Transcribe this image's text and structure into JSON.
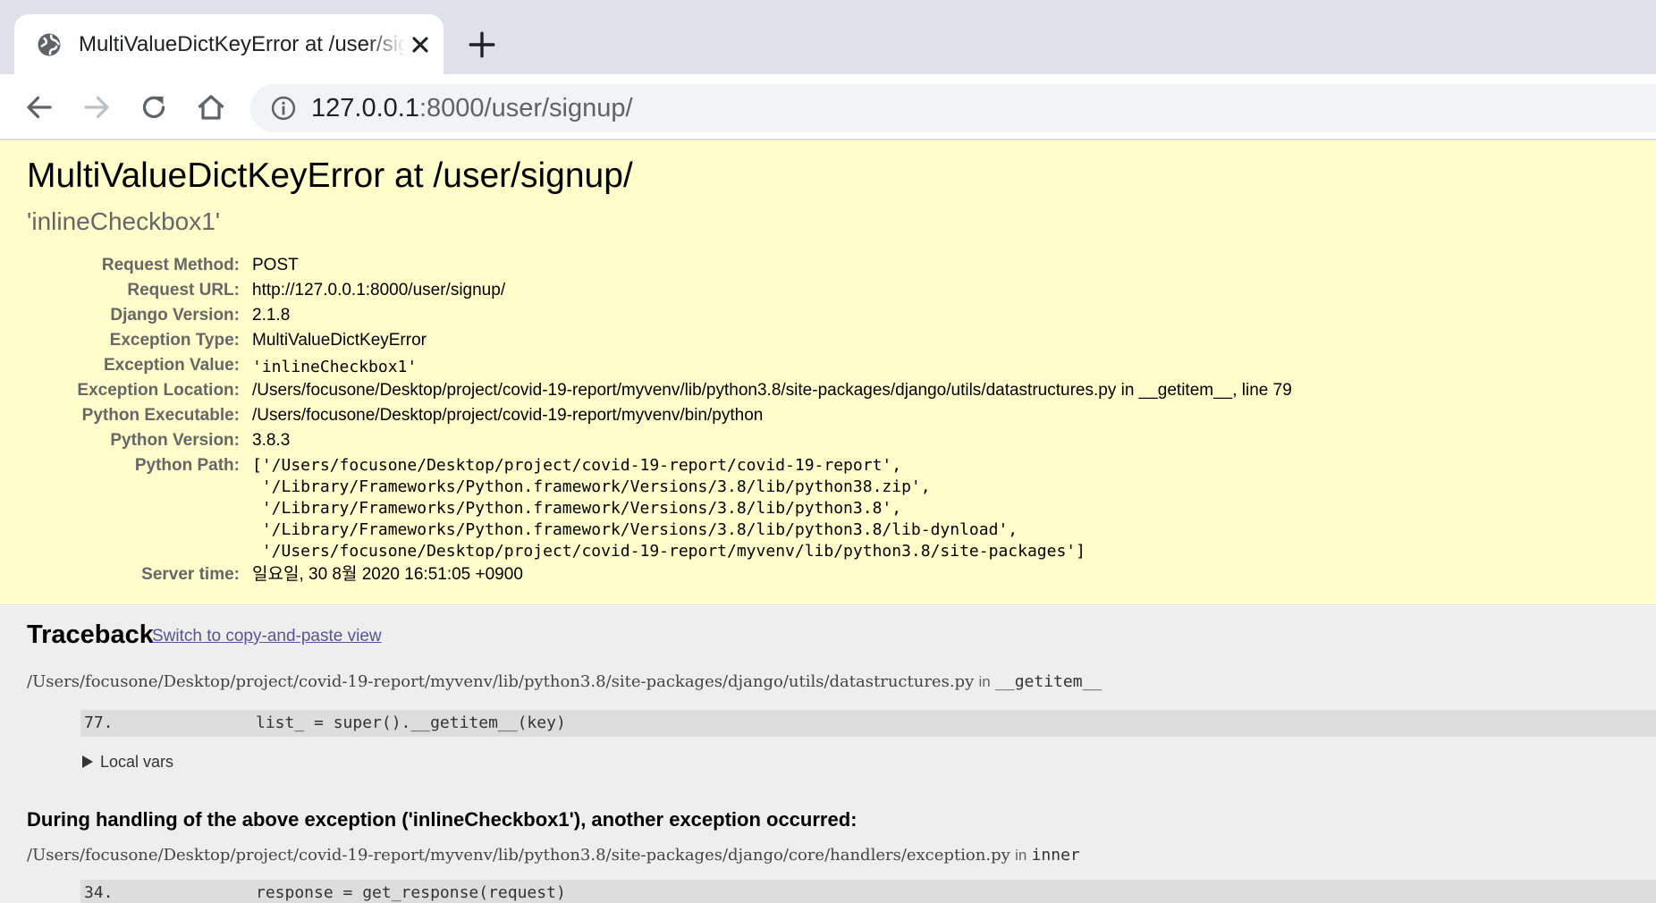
{
  "browser": {
    "tab_title": "MultiValueDictKeyError at /user/signup/",
    "url_host": "127.0.0.1",
    "url_rest": ":8000/user/signup/"
  },
  "error": {
    "title": "MultiValueDictKeyError at /user/signup/",
    "subtitle": "'inlineCheckbox1'"
  },
  "meta": {
    "request_method": {
      "label": "Request Method:",
      "value": "POST"
    },
    "request_url": {
      "label": "Request URL:",
      "value": "http://127.0.0.1:8000/user/signup/"
    },
    "django_version": {
      "label": "Django Version:",
      "value": "2.1.8"
    },
    "exception_type": {
      "label": "Exception Type:",
      "value": "MultiValueDictKeyError"
    },
    "exception_value": {
      "label": "Exception Value:",
      "value": "'inlineCheckbox1'"
    },
    "exception_location": {
      "label": "Exception Location:",
      "value": "/Users/focusone/Desktop/project/covid-19-report/myvenv/lib/python3.8/site-packages/django/utils/datastructures.py in __getitem__, line 79"
    },
    "python_executable": {
      "label": "Python Executable:",
      "value": "/Users/focusone/Desktop/project/covid-19-report/myvenv/bin/python"
    },
    "python_version": {
      "label": "Python Version:",
      "value": "3.8.3"
    },
    "python_path": {
      "label": "Python Path:",
      "lines": [
        "['/Users/focusone/Desktop/project/covid-19-report/covid-19-report',",
        " '/Library/Frameworks/Python.framework/Versions/3.8/lib/python38.zip',",
        " '/Library/Frameworks/Python.framework/Versions/3.8/lib/python3.8',",
        " '/Library/Frameworks/Python.framework/Versions/3.8/lib/python3.8/lib-dynload',",
        " '/Users/focusone/Desktop/project/covid-19-report/myvenv/lib/python3.8/site-packages']"
      ]
    },
    "server_time": {
      "label": "Server time:",
      "value": "일요일, 30 8월 2020 16:51:05 +0900"
    }
  },
  "traceback": {
    "title": "Traceback",
    "switch_link": "Switch to copy-and-paste view",
    "frames": [
      {
        "file": "/Users/focusone/Desktop/project/covid-19-report/myvenv/lib/python3.8/site-packages/django/utils/datastructures.py",
        "in": "in",
        "function": "__getitem__",
        "line_no": "77.",
        "code": "list_ = super().__getitem__(key)",
        "local_vars": "Local vars"
      },
      {
        "file": "/Users/focusone/Desktop/project/covid-19-report/myvenv/lib/python3.8/site-packages/django/core/handlers/exception.py",
        "in": "in",
        "function": "inner",
        "line_no": "34.",
        "code": "response = get_response(request)"
      }
    ],
    "during_handling": "During handling of the above exception ('inlineCheckbox1'), another exception occurred:"
  }
}
